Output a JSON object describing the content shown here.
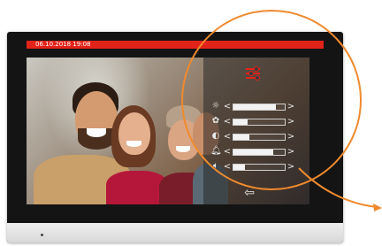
{
  "status_bar": {
    "datetime": "06.10.2018   19:08",
    "color": "#e2231a"
  },
  "settings_panel": {
    "menu_icon": "sliders-icon",
    "controls": [
      {
        "icon": "brightness-icon",
        "glyph": "☼",
        "level": 0.82
      },
      {
        "icon": "color-saturation-icon",
        "glyph": "✿",
        "level": 0.27
      },
      {
        "icon": "contrast-icon",
        "glyph": "◐",
        "level": 0.31
      },
      {
        "icon": "bell-icon",
        "glyph": "🔔︎",
        "level": 0.78
      },
      {
        "icon": "speaker-icon",
        "glyph": "🔈︎",
        "level": 0.23
      }
    ],
    "back_icon": "back-arrow-icon"
  },
  "callout": {
    "color": "#f08a2e"
  }
}
